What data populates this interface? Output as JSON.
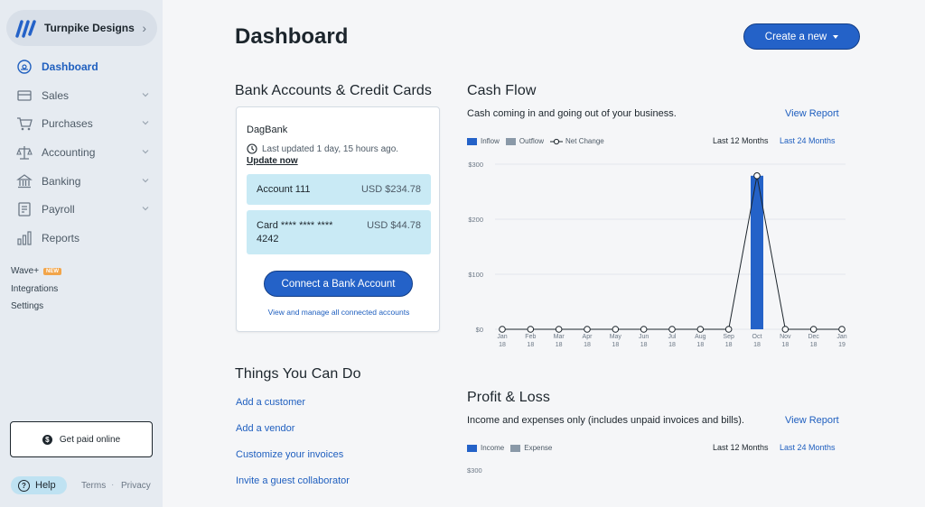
{
  "sidebar": {
    "business_name": "Turnpike Designs",
    "items": [
      {
        "label": "Dashboard",
        "icon": "dashboard-icon",
        "active": true,
        "expandable": false
      },
      {
        "label": "Sales",
        "icon": "sales-icon",
        "active": false,
        "expandable": true
      },
      {
        "label": "Purchases",
        "icon": "cart-icon",
        "active": false,
        "expandable": true
      },
      {
        "label": "Accounting",
        "icon": "scale-icon",
        "active": false,
        "expandable": true
      },
      {
        "label": "Banking",
        "icon": "bank-icon",
        "active": false,
        "expandable": true
      },
      {
        "label": "Payroll",
        "icon": "payroll-icon",
        "active": false,
        "expandable": true
      },
      {
        "label": "Reports",
        "icon": "reports-icon",
        "active": false,
        "expandable": false
      }
    ],
    "wave_plus": "Wave+",
    "new_badge": "NEW",
    "integrations": "Integrations",
    "settings": "Settings",
    "get_paid": "Get paid online",
    "help": "Help",
    "terms": "Terms",
    "dot": "·",
    "privacy": "Privacy"
  },
  "header": {
    "title": "Dashboard",
    "create_label": "Create a new"
  },
  "bank": {
    "section_title": "Bank Accounts & Credit Cards",
    "bank_name": "DagBank",
    "last_updated": "Last updated 1 day, 15 hours ago.",
    "update_now": "Update now",
    "accounts": [
      {
        "name": "Account 111",
        "amount": "USD $234.78"
      },
      {
        "name": "Card **** **** **** 4242",
        "amount": "USD $44.78"
      }
    ],
    "connect_label": "Connect a Bank Account",
    "manage_link": "View and manage all connected accounts"
  },
  "todo": {
    "section_title": "Things You Can Do",
    "links": [
      "Add a customer",
      "Add a vendor",
      "Customize your invoices",
      "Invite a guest collaborator"
    ]
  },
  "cashflow": {
    "section_title": "Cash Flow",
    "subtitle": "Cash coming in and going out of your business.",
    "view_report": "View Report",
    "legend": [
      "Inflow",
      "Outflow",
      "Net Change"
    ],
    "period_a": "Last 12 Months",
    "period_b": "Last 24 Months"
  },
  "pnl": {
    "section_title": "Profit & Loss",
    "subtitle": "Income and expenses only (includes unpaid invoices and bills).",
    "view_report": "View Report",
    "legend": [
      "Income",
      "Expense"
    ],
    "period_a": "Last 12 Months",
    "period_b": "Last 24 Months",
    "y_top_label": "$300"
  },
  "colors": {
    "inflow": "#2462c8",
    "outflow": "#8a99a8",
    "net_line": "#1c252c",
    "accent": "#1f5fbf"
  },
  "chart_data": {
    "type": "bar",
    "categories": [
      "Jan 18",
      "Feb 18",
      "Mar 18",
      "Apr 18",
      "May 18",
      "Jun 18",
      "Jul 18",
      "Aug 18",
      "Sep 18",
      "Oct 18",
      "Nov 18",
      "Dec 18",
      "Jan 19"
    ],
    "series": [
      {
        "name": "Inflow",
        "values": [
          0,
          0,
          0,
          0,
          0,
          0,
          0,
          0,
          0,
          279,
          0,
          0,
          0
        ]
      },
      {
        "name": "Outflow",
        "values": [
          0,
          0,
          0,
          0,
          0,
          0,
          0,
          0,
          0,
          0,
          0,
          0,
          0
        ]
      },
      {
        "name": "Net Change",
        "type": "line",
        "values": [
          0,
          0,
          0,
          0,
          0,
          0,
          0,
          0,
          0,
          279,
          0,
          0,
          0
        ]
      }
    ],
    "yticks": [
      "$0",
      "$100",
      "$200",
      "$300"
    ],
    "ylim": [
      0,
      300
    ],
    "grid": true
  }
}
